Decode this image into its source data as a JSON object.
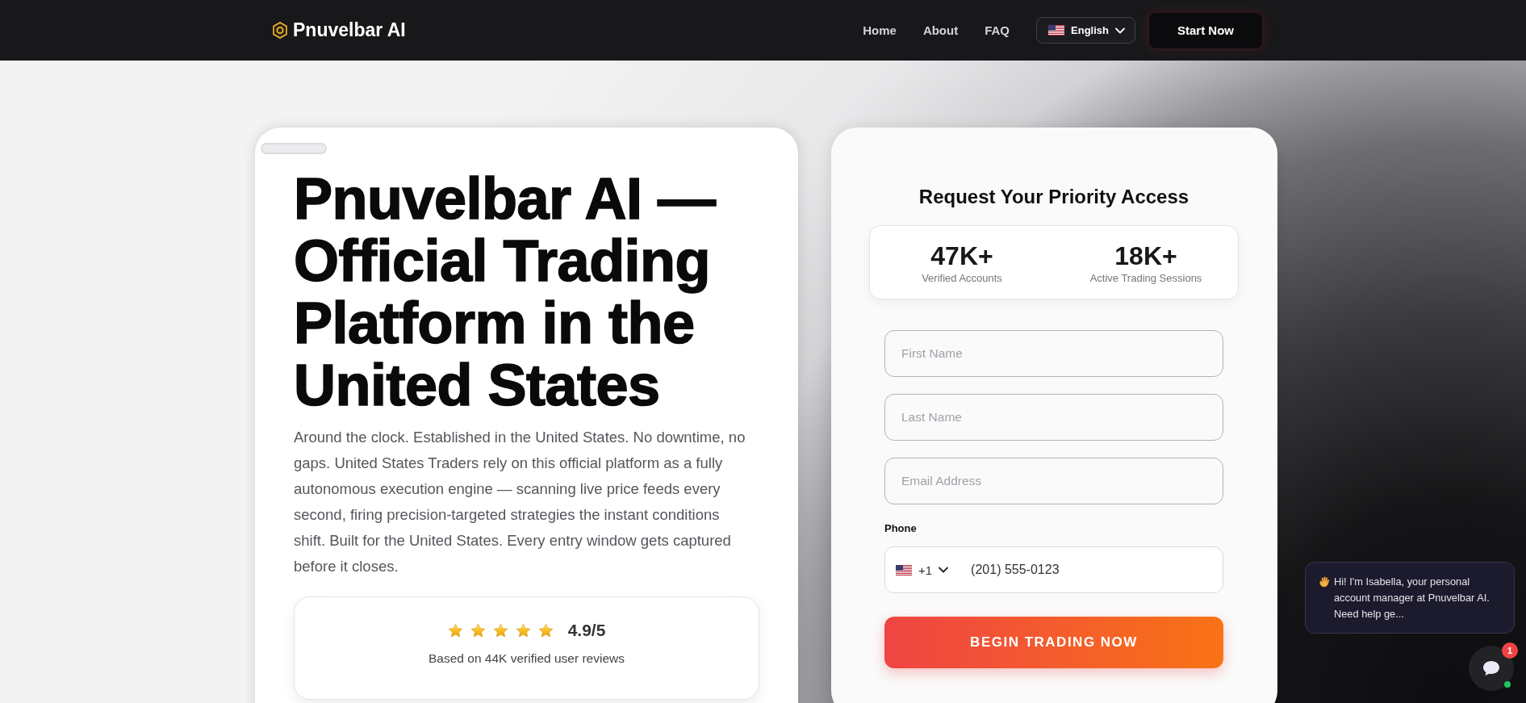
{
  "header": {
    "logo": "Pnuvelbar AI",
    "nav": [
      {
        "label": "Home"
      },
      {
        "label": "About"
      },
      {
        "label": "FAQ"
      }
    ],
    "language": {
      "label": "English"
    },
    "cta": "Start Now"
  },
  "hero": {
    "title": "Pnuvelbar AI — Official Trading Platform in the United States",
    "description": "Around the clock. Established in the United States. No downtime, no gaps. United States Traders rely on this official platform as a fully autonomous execution engine — scanning live price feeds every second, firing precision-targeted strategies the instant conditions shift. Built for the United States. Every entry window gets captured before it closes.",
    "rating": {
      "stars": 5,
      "score": "4.9/5",
      "caption": "Based on 44K verified user reviews"
    }
  },
  "form": {
    "title": "Request Your Priority Access",
    "stats": [
      {
        "value": "47K+",
        "label": "Verified Accounts"
      },
      {
        "value": "18K+",
        "label": "Active Trading Sessions"
      }
    ],
    "fields": [
      {
        "placeholder": "First Name"
      },
      {
        "placeholder": "Last Name"
      },
      {
        "placeholder": "Email Address"
      }
    ],
    "phone": {
      "label": "Phone",
      "code": "+1",
      "value": "(201) 555-0123"
    },
    "submit": "BEGIN TRADING NOW"
  },
  "chat": {
    "message": "Hi! I'm Isabella, your personal account manager at Pnuvelbar AI. Need help ge...",
    "badge": "1",
    "online": true
  }
}
